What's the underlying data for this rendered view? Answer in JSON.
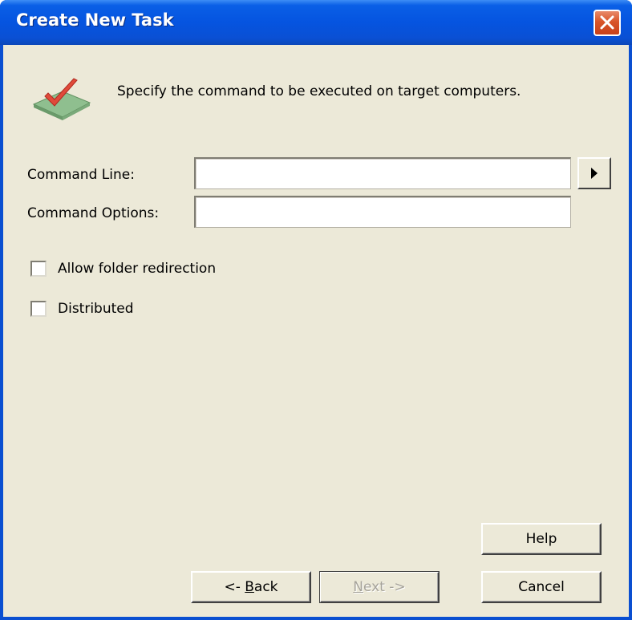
{
  "window": {
    "title": "Create New Task"
  },
  "header": {
    "instruction": "Specify the command to be executed on target computers."
  },
  "form": {
    "command_line_label": "Command Line:",
    "command_line_value": "",
    "command_options_label": "Command Options:",
    "command_options_value": ""
  },
  "checkboxes": [
    {
      "label": "Allow folder redirection",
      "checked": false
    },
    {
      "label": "Distributed",
      "checked": false
    }
  ],
  "buttons": {
    "help": "Help",
    "back_prefix": "<- ",
    "back_mnemonic": "B",
    "back_rest": "ack",
    "next_mnemonic": "N",
    "next_rest": "ext ->",
    "next_enabled": false,
    "cancel": "Cancel"
  },
  "colors": {
    "titlebar": "#0554e0",
    "dialog_bg": "#ece9d8",
    "close_button": "#d9552a"
  }
}
